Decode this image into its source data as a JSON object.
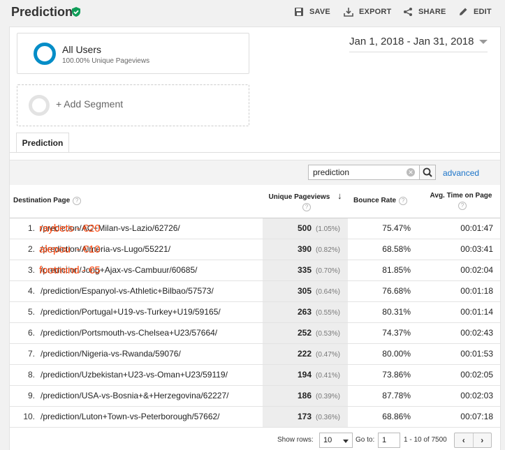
{
  "header": {
    "title": "Prediction",
    "save_label": "SAVE",
    "export_label": "EXPORT",
    "share_label": "SHARE",
    "edit_label": "EDIT"
  },
  "segments": {
    "all_users": {
      "name": "All Users",
      "sub": "100.00% Unique Pageviews"
    },
    "add_segment": "+ Add Segment"
  },
  "date_range": "Jan 1, 2018 - Jan 31, 2018",
  "tab": "Prediction",
  "search": {
    "value": "prediction",
    "advanced": "advanced"
  },
  "columns": {
    "destination": "Destination Page",
    "unique_pageviews": "Unique Pageviews",
    "bounce_rate": "Bounce Rate",
    "avg_time": "Avg. Time on Page"
  },
  "rows": [
    {
      "idx": "1.",
      "page": "/prediction/AC+Milan-vs-Lazio/62726/",
      "promo": "raybets - €20",
      "upv": "500",
      "pct": "(1.05%)",
      "bounce": "75.47%",
      "time": "00:01:47"
    },
    {
      "idx": "2.",
      "page": "/prediction/Almeria-vs-Lugo/55221/",
      "promo": "alepou  - €10",
      "upv": "390",
      "pct": "(0.82%)",
      "bounce": "68.58%",
      "time": "00:03:41"
    },
    {
      "idx": "3.",
      "page": "/prediction/Jong+Ajax-vs-Cambuur/60685/",
      "promo": "footmind - €5",
      "upv": "335",
      "pct": "(0.70%)",
      "bounce": "81.85%",
      "time": "00:02:04"
    },
    {
      "idx": "4.",
      "page": "/prediction/Espanyol-vs-Athletic+Bilbao/57573/",
      "promo": "",
      "upv": "305",
      "pct": "(0.64%)",
      "bounce": "76.68%",
      "time": "00:01:18"
    },
    {
      "idx": "5.",
      "page": "/prediction/Portugal+U19-vs-Turkey+U19/59165/",
      "promo": "",
      "upv": "263",
      "pct": "(0.55%)",
      "bounce": "80.31%",
      "time": "00:01:14"
    },
    {
      "idx": "6.",
      "page": "/prediction/Portsmouth-vs-Chelsea+U23/57664/",
      "promo": "",
      "upv": "252",
      "pct": "(0.53%)",
      "bounce": "74.37%",
      "time": "00:02:43"
    },
    {
      "idx": "7.",
      "page": "/prediction/Nigeria-vs-Rwanda/59076/",
      "promo": "",
      "upv": "222",
      "pct": "(0.47%)",
      "bounce": "80.00%",
      "time": "00:01:53"
    },
    {
      "idx": "8.",
      "page": "/prediction/Uzbekistan+U23-vs-Oman+U23/59119/",
      "promo": "",
      "upv": "194",
      "pct": "(0.41%)",
      "bounce": "73.86%",
      "time": "00:02:05"
    },
    {
      "idx": "9.",
      "page": "/prediction/USA-vs-Bosnia+&+Herzegovina/62227/",
      "promo": "",
      "upv": "186",
      "pct": "(0.39%)",
      "bounce": "87.78%",
      "time": "00:02:03"
    },
    {
      "idx": "10.",
      "page": "/prediction/Luton+Town-vs-Peterborough/57662/",
      "promo": "",
      "upv": "173",
      "pct": "(0.36%)",
      "bounce": "68.86%",
      "time": "00:07:18"
    }
  ],
  "footer": {
    "show_rows_label": "Show rows:",
    "show_rows_value": "10",
    "goto_label": "Go to:",
    "goto_value": "1",
    "range": "1 - 10 of 7500",
    "prev": "‹",
    "next": "›"
  },
  "colors": {
    "accent": "#058dc7",
    "verified": "#0f9d58",
    "promo": "#ff4a12",
    "link": "#1a73c8"
  }
}
